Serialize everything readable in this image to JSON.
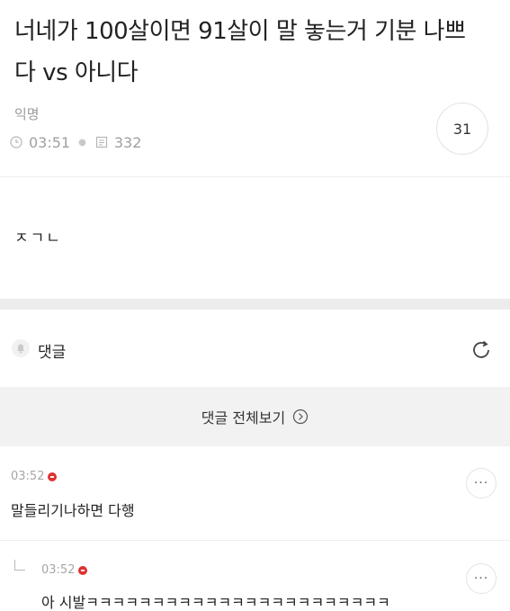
{
  "post": {
    "title": "너네가 100살이면 91살이 말 놓는거 기분 나쁘다 vs 아니다",
    "author": "익명",
    "time": "03:51",
    "views": "332",
    "comment_count": "31",
    "body": "ㅈㄱㄴ"
  },
  "comments_section": {
    "label": "댓글",
    "view_all_label": "댓글 전체보기",
    "comments": [
      {
        "time": "03:52",
        "text": "말들리기나하면 다행"
      }
    ],
    "replies": [
      {
        "time": "03:52",
        "text": "아 시발ㅋㅋㅋㅋㅋㅋㅋㅋㅋㅋㅋㅋㅋㅋㅋㅋㅋㅋㅋㅋㅋㅋㅋ"
      }
    ],
    "more_label": "···"
  },
  "colors": {
    "new_badge": "#e03131",
    "section_gap": "#ececec",
    "view_all_bg": "#f2f2f2"
  },
  "icons": [
    "clock-icon",
    "views-icon",
    "bell-icon",
    "refresh-icon",
    "arrow-circle-icon",
    "more-icon",
    "reply-arrow-icon"
  ]
}
